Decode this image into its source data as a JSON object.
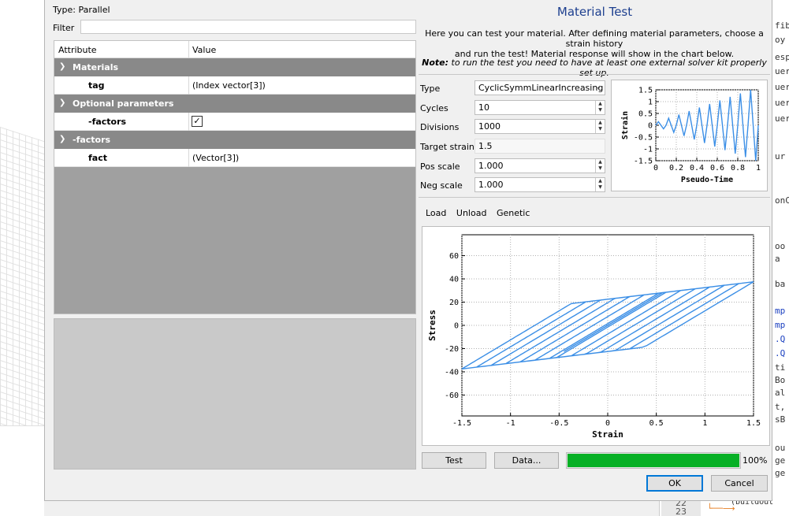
{
  "left": {
    "type_label": "Type:",
    "type_value": "Parallel",
    "filter_label": "Filter",
    "filter_value": "",
    "table": {
      "col_attribute": "Attribute",
      "col_value": "Value",
      "groups": [
        {
          "label": "Materials",
          "rows": [
            {
              "attr": "tag",
              "value": "(Index vector[3])"
            }
          ]
        },
        {
          "label": "Optional parameters",
          "rows": [
            {
              "attr": "-factors",
              "checked": true
            }
          ]
        },
        {
          "label": "-factors",
          "rows": [
            {
              "attr": "fact",
              "value": "(Vector[3])"
            }
          ]
        }
      ]
    }
  },
  "material_test": {
    "title": "Material Test",
    "description_line1": "Here you can test your material. After defining material parameters, choose a strain history",
    "description_line2": "and run the test! Material response will show in the chart below.",
    "note_prefix": "Note:",
    "note_text": " to run the test you need to have at least one external solver kit properly set up.",
    "params": {
      "type_label": "Type",
      "type_value": "CyclicSymmLinearIncreasing",
      "cycles_label": "Cycles",
      "cycles_value": "10",
      "divisions_label": "Divisions",
      "divisions_value": "1000",
      "target_strain_label": "Target strain",
      "target_strain_value": "1.5",
      "pos_scale_label": "Pos scale",
      "pos_scale_value": "1.000",
      "neg_scale_label": "Neg scale",
      "neg_scale_value": "1.000"
    },
    "tabs": [
      "Load",
      "Unload",
      "Genetic"
    ],
    "buttons": {
      "test": "Test",
      "data": "Data...",
      "ok": "OK",
      "cancel": "Cancel"
    },
    "progress": {
      "value": 100,
      "label": "100%"
    }
  },
  "background": {
    "right_code": [
      "fibe",
      "oy",
      "esp",
      "uer",
      "uer",
      "uer",
      "uer",
      "ur F",
      "onC",
      "oo",
      "a",
      "ba",
      "mp",
      "mp",
      ".Q",
      ".Q",
      "ti",
      "Bo",
      "al",
      "t,",
      "sB",
      "ou",
      "ge",
      "ge"
    ],
    "line_numbers": [
      "22",
      "23"
    ],
    "snippet": "(buildOut"
  },
  "colors": {
    "accent": "#1d3f8f",
    "series": "#3c8fe6",
    "progress": "#06b025",
    "group_header": "#898989"
  },
  "chart_data": [
    {
      "type": "line",
      "title": "",
      "xlabel": "Pseudo-Time",
      "ylabel": "Strain",
      "xlim": [
        0,
        1
      ],
      "ylim": [
        -1.5,
        1.5
      ],
      "xticks": [
        "0",
        "0.2",
        "0.4",
        "0.6",
        "0.8",
        "1"
      ],
      "yticks": [
        "1.5",
        "1",
        "0.5",
        "0",
        "-0.5",
        "-1",
        "-1.5"
      ],
      "grid": true,
      "series": [
        {
          "x": [
            0,
            0.025,
            0.075,
            0.1,
            0.125,
            0.175,
            0.2,
            0.225,
            0.275,
            0.3,
            0.325,
            0.375,
            0.4,
            0.425,
            0.475,
            0.5,
            0.525,
            0.575,
            0.6,
            0.625,
            0.675,
            0.7,
            0.725,
            0.775,
            0.8,
            0.825,
            0.875,
            0.9,
            0.925,
            0.975,
            1.0
          ],
          "y": [
            0,
            0.15,
            -0.15,
            0,
            0.3,
            -0.3,
            0,
            0.45,
            -0.45,
            0,
            0.6,
            -0.6,
            0,
            0.75,
            -0.75,
            0,
            0.9,
            -0.9,
            0,
            1.05,
            -1.05,
            0,
            1.2,
            -1.2,
            0,
            1.35,
            -1.35,
            0,
            1.5,
            -1.5,
            0
          ]
        }
      ]
    },
    {
      "type": "line",
      "title": "",
      "xlabel": "Strain",
      "ylabel": "Stress",
      "xlim": [
        -1.5,
        1.5
      ],
      "ylim": [
        -78,
        78
      ],
      "xticks": [
        "-1.5",
        "-1",
        "-0.5",
        "0",
        "0.5",
        "1",
        "1.5"
      ],
      "yticks": [
        "60",
        "40",
        "20",
        "0",
        "-20",
        "-40",
        "-60"
      ],
      "grid": true,
      "hysteresis": {
        "E0": 50,
        "b": 0.2,
        "fy": 22.5,
        "amplitudes": [
          0.15,
          0.3,
          0.45,
          0.6,
          0.75,
          0.9,
          1.05,
          1.2,
          1.35,
          1.5
        ]
      }
    }
  ]
}
